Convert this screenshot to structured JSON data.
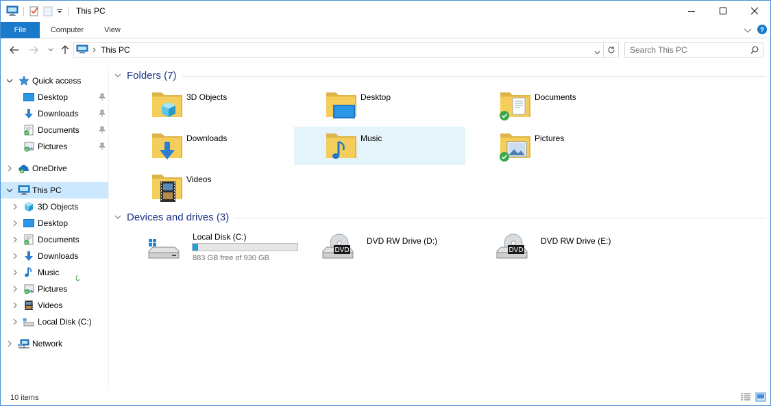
{
  "window": {
    "title": "This PC"
  },
  "ribbon": {
    "tabs": [
      {
        "label": "File"
      },
      {
        "label": "Computer"
      },
      {
        "label": "View"
      }
    ]
  },
  "address": {
    "path": "This PC",
    "search_placeholder": "Search This PC"
  },
  "navpane": {
    "quick_access": {
      "label": "Quick access",
      "items": [
        {
          "label": "Desktop"
        },
        {
          "label": "Downloads"
        },
        {
          "label": "Documents"
        },
        {
          "label": "Pictures"
        }
      ]
    },
    "onedrive": {
      "label": "OneDrive"
    },
    "this_pc": {
      "label": "This PC",
      "items": [
        {
          "label": "3D Objects"
        },
        {
          "label": "Desktop"
        },
        {
          "label": "Documents"
        },
        {
          "label": "Downloads"
        },
        {
          "label": "Music"
        },
        {
          "label": "Pictures"
        },
        {
          "label": "Videos"
        },
        {
          "label": "Local Disk (C:)"
        }
      ]
    },
    "network": {
      "label": "Network"
    }
  },
  "content": {
    "folders_header": "Folders (7)",
    "folders": [
      {
        "label": "3D Objects",
        "icon": "folder-3d-objects-icon"
      },
      {
        "label": "Desktop",
        "icon": "folder-desktop-icon"
      },
      {
        "label": "Documents",
        "icon": "folder-documents-icon"
      },
      {
        "label": "Downloads",
        "icon": "folder-downloads-icon"
      },
      {
        "label": "Music",
        "icon": "folder-music-icon"
      },
      {
        "label": "Pictures",
        "icon": "folder-pictures-icon"
      },
      {
        "label": "Videos",
        "icon": "folder-videos-icon"
      }
    ],
    "drives_header": "Devices and drives (3)",
    "drives": [
      {
        "label": "Local Disk (C:)",
        "free_text": "883 GB free of 930 GB",
        "used_fraction": 0.05
      },
      {
        "label": "DVD RW Drive (D:)",
        "badge": "DVD"
      },
      {
        "label": "DVD RW Drive (E:)",
        "badge": "DVD"
      }
    ]
  },
  "status": {
    "item_count": "10 items"
  },
  "colors": {
    "accent": "#1979ca",
    "selection": "#cce8ff",
    "hover": "#e5f3fb",
    "group_header": "#1e3287",
    "folder": "#f0c34a",
    "progress": "#26a0da"
  }
}
